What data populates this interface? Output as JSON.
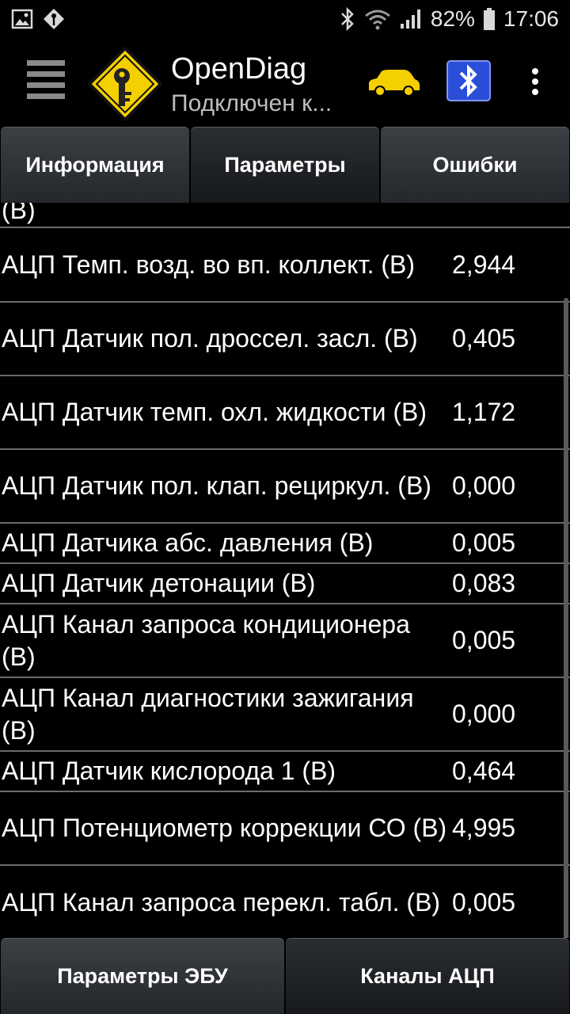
{
  "status_bar": {
    "battery": "82%",
    "time": "17:06"
  },
  "app_bar": {
    "title": "OpenDiag",
    "subtitle": "Подключен к..."
  },
  "tabs": [
    {
      "label": "Информация"
    },
    {
      "label": "Параметры"
    },
    {
      "label": "Ошибки"
    }
  ],
  "list": {
    "partial_label": "(В)",
    "rows": [
      {
        "label": "АЦП Темп. возд. во вп. коллект. (В)",
        "value": "2,944"
      },
      {
        "label": "АЦП Датчик пол. дроссел. засл. (В)",
        "value": "0,405"
      },
      {
        "label": "АЦП Датчик темп. охл. жидкости (В)",
        "value": "1,172"
      },
      {
        "label": "АЦП Датчик пол. клап. рециркул. (В)",
        "value": "0,000"
      },
      {
        "label": "АЦП Датчика абс. давления (В)",
        "value": "0,005"
      },
      {
        "label": "АЦП Датчик детонации (В)",
        "value": "0,083"
      },
      {
        "label": "АЦП Канал запроса кондиционера (В)",
        "value": "0,005"
      },
      {
        "label": "АЦП Канал диагностики зажигания (В)",
        "value": "0,000"
      },
      {
        "label": "АЦП Датчик кислорода 1 (В)",
        "value": "0,464"
      },
      {
        "label": "АЦП Потенциометр коррекции СО (В)",
        "value": "4,995"
      },
      {
        "label": "АЦП Канал запроса перекл. табл. (В)",
        "value": "0,005"
      }
    ]
  },
  "bottom_tabs": [
    {
      "label": "Параметры ЭБУ"
    },
    {
      "label": "Каналы АЦП"
    }
  ],
  "icons": {
    "gallery": "gallery-icon",
    "notification": "opendiag-notification-icon",
    "bluetooth": "bluetooth-icon",
    "wifi": "wifi-icon",
    "signal": "signal-icon",
    "battery": "battery-icon",
    "menu": "menu-icon",
    "logo": "opendiag-logo-icon",
    "car": "car-icon",
    "bt_adapter": "bluetooth-adapter-icon",
    "overflow": "overflow-menu-icon"
  },
  "colors": {
    "background": "#000000",
    "logo_yellow": "#f5d000",
    "car_yellow": "#f5d000",
    "bt_blue": "#2a4ed8"
  }
}
